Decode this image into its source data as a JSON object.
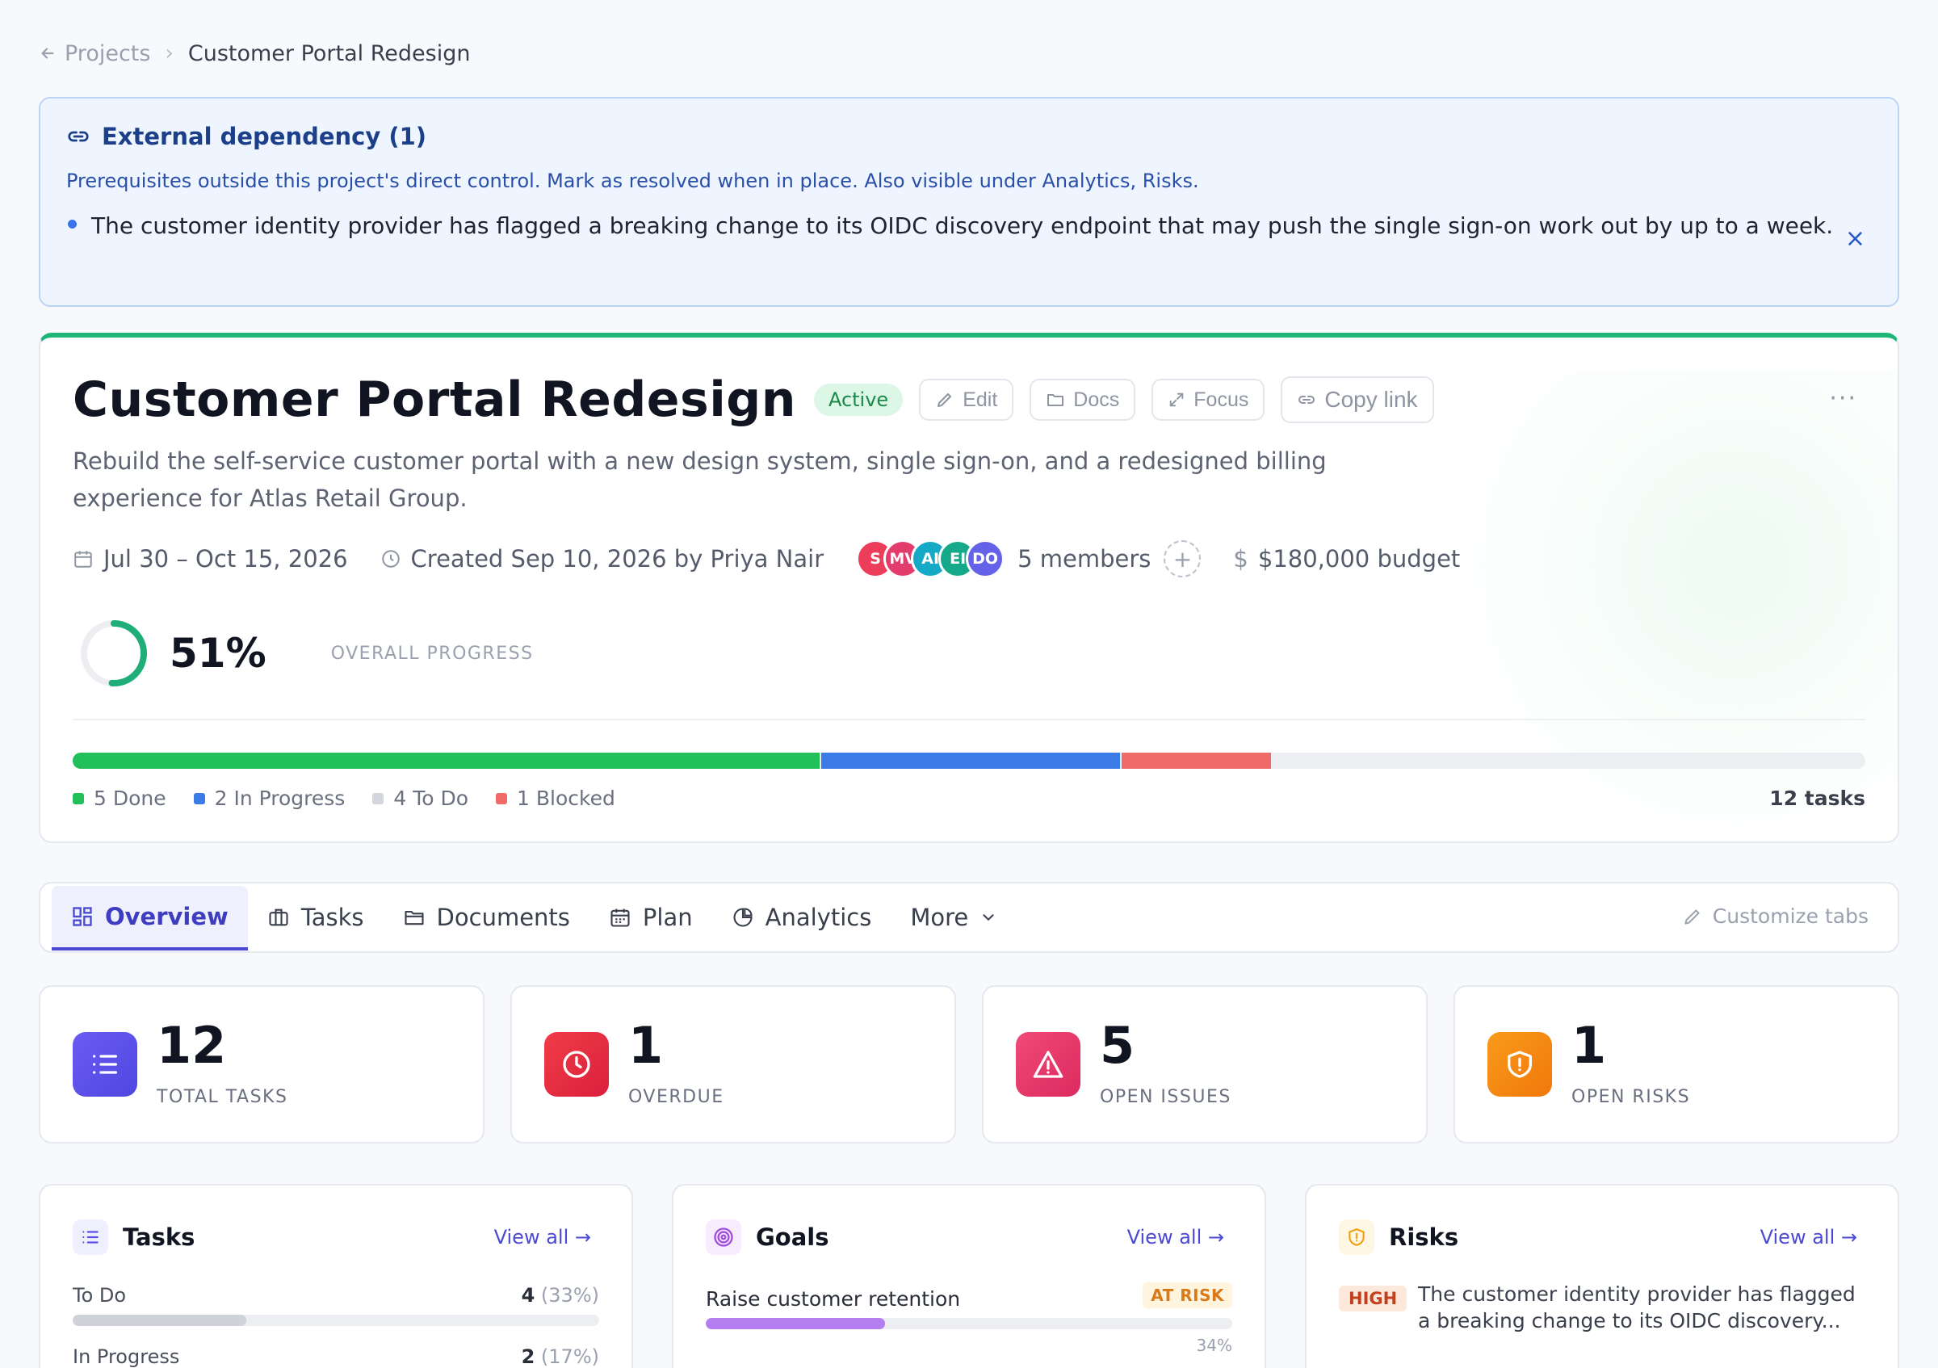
{
  "breadcrumb": {
    "parent": "Projects",
    "current": "Customer Portal Redesign"
  },
  "banner": {
    "title": "External dependency (1)",
    "description": "Prerequisites outside this project's direct control. Mark as resolved when in place. Also visible under Analytics, Risks.",
    "item": "The customer identity provider has flagged a breaking change to its OIDC discovery endpoint that may push the single sign-on work out by up to a week.",
    "close_icon": "×"
  },
  "project": {
    "title": "Customer Portal Redesign",
    "status": "Active",
    "actions": {
      "edit": "Edit",
      "docs": "Docs",
      "focus": "Focus",
      "copy_link": "Copy link"
    },
    "more": "···",
    "description": "Rebuild the self-service customer portal with a new design system, single sign-on, and a redesigned billing experience for Atlas Retail Group.",
    "dates": "Jul 30 – Oct 15, 2026",
    "created": "Created Sep 10, 2026 by Priya Nair",
    "avatars": [
      {
        "initials": "S",
        "color": "#ec3d5a"
      },
      {
        "initials": "MV",
        "color": "#e23c6c"
      },
      {
        "initials": "AI",
        "color": "#14a9c6"
      },
      {
        "initials": "EI",
        "color": "#15a98a"
      },
      {
        "initials": "DO",
        "color": "#6462e8"
      }
    ],
    "members": "5 members",
    "add_member": "+",
    "budget": "$180,000 budget",
    "progress_percent": 51,
    "progress_text": "51%",
    "progress_label": "OVERALL PROGRESS",
    "status_breakdown": [
      {
        "label": "5 Done",
        "count": 5,
        "color": "#22c05a"
      },
      {
        "label": "2 In Progress",
        "count": 2,
        "color": "#3b7be8"
      },
      {
        "label": "4 To Do",
        "count": 4,
        "color": "#d3d6dd"
      },
      {
        "label": "1 Blocked",
        "count": 1,
        "color": "#f06a6a"
      }
    ],
    "total_tasks_label": "12 tasks",
    "accent_color": "#1fb57a"
  },
  "tabs": {
    "items": [
      {
        "label": "Overview",
        "icon": "grid-icon",
        "active": true
      },
      {
        "label": "Tasks",
        "icon": "briefcase-icon",
        "active": false
      },
      {
        "label": "Documents",
        "icon": "folder-icon",
        "active": false
      },
      {
        "label": "Plan",
        "icon": "calendar-icon",
        "active": false
      },
      {
        "label": "Analytics",
        "icon": "pie-chart-icon",
        "active": false
      },
      {
        "label": "More",
        "icon": "chevron-down-icon",
        "active": false
      }
    ],
    "customize": "Customize tabs"
  },
  "stats": [
    {
      "value": "12",
      "label": "TOTAL TASKS",
      "icon": "list-icon",
      "color": "#5b50e6"
    },
    {
      "value": "1",
      "label": "OVERDUE",
      "icon": "clock-icon",
      "color": "#e5293f"
    },
    {
      "value": "5",
      "label": "OPEN ISSUES",
      "icon": "warning-icon",
      "color": "#e93a6a"
    },
    {
      "value": "1",
      "label": "OPEN RISKS",
      "icon": "shield-icon",
      "color": "#f5870f"
    }
  ],
  "panels": {
    "tasks": {
      "title": "Tasks",
      "view_all": "View all →",
      "rows": [
        {
          "label": "To Do",
          "count": "4",
          "pct": "(33%)",
          "fraction": 0.33,
          "color": "#cfd2d9"
        },
        {
          "label": "In Progress",
          "count": "2",
          "pct": "(17%)",
          "fraction": 0.17,
          "color": "#3b7be8"
        }
      ]
    },
    "goals": {
      "title": "Goals",
      "view_all": "View all →",
      "goal": "Raise customer retention",
      "badge": "AT RISK",
      "percent_text": "34%",
      "fraction": 0.34,
      "color": "#b57ef0"
    },
    "risks": {
      "title": "Risks",
      "view_all": "View all →",
      "severity": "HIGH",
      "text": "The customer identity provider has flagged a breaking change to its OIDC discovery..."
    }
  }
}
